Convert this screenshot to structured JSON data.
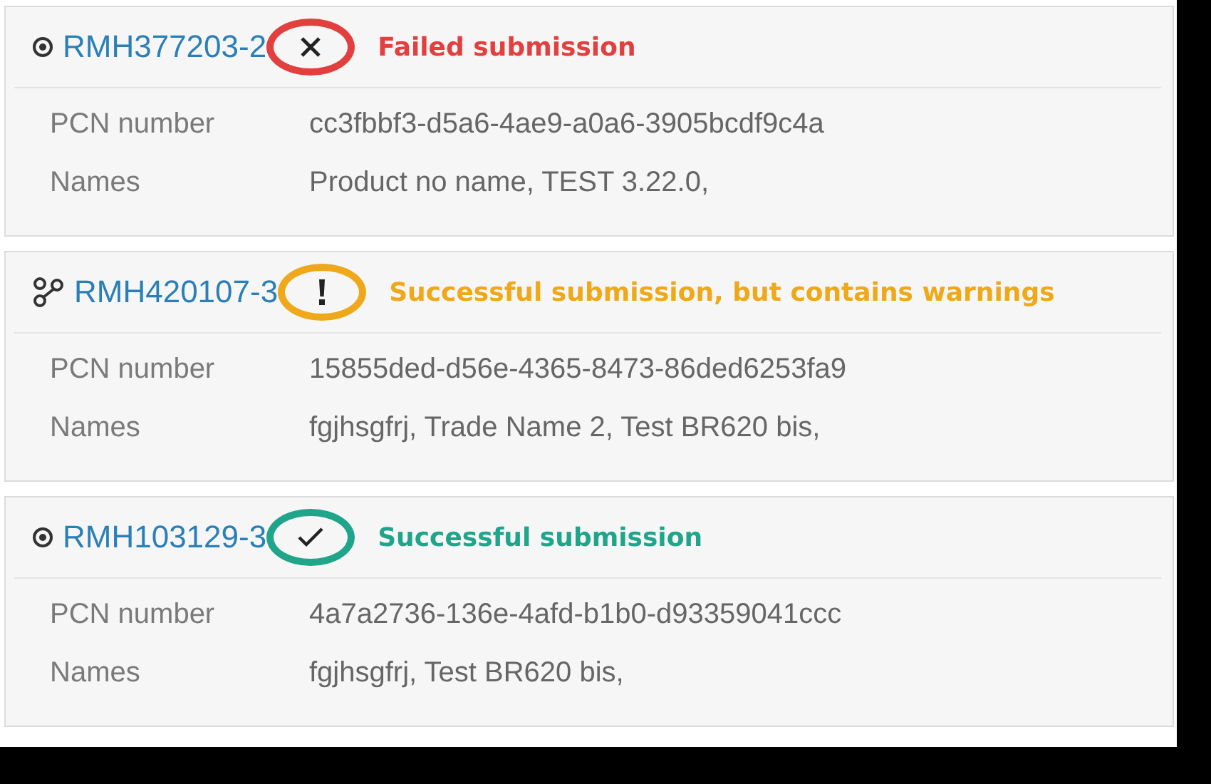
{
  "submissions": [
    {
      "id_link": {
        "text": "RMH377203-2",
        "kind": "target"
      },
      "status": {
        "kind": "failed",
        "color": "#e2403f",
        "note": "Failed submission"
      },
      "fields": [
        {
          "label": "PCN number",
          "value": "cc3fbbf3-d5a6-4ae9-a0a6-3905bcdf9c4a"
        },
        {
          "label": "Names",
          "value": "Product no name, TEST 3.22.0,"
        }
      ]
    },
    {
      "id_link": {
        "text": "RMH420107-3",
        "kind": "branch"
      },
      "status": {
        "kind": "warning",
        "color": "#efa81a",
        "note": "Successful submission, but contains warnings"
      },
      "fields": [
        {
          "label": "PCN number",
          "value": "15855ded-d56e-4365-8473-86ded6253fa9"
        },
        {
          "label": "Names",
          "value": "fgjhsgfrj, Trade Name 2, Test BR620 bis,"
        }
      ]
    },
    {
      "id_link": {
        "text": "RMH103129-3",
        "kind": "target"
      },
      "status": {
        "kind": "success",
        "color": "#1fa58a",
        "note": "Successful submission"
      },
      "fields": [
        {
          "label": "PCN number",
          "value": "4a7a2736-136e-4afd-b1b0-d93359041ccc"
        },
        {
          "label": "Names",
          "value": "fgjhsgfrj, Test BR620 bis,"
        }
      ]
    }
  ]
}
